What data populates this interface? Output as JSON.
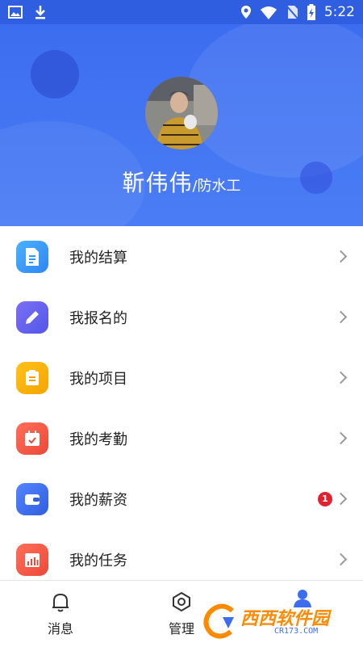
{
  "status_bar": {
    "time": "5:22",
    "left_icons": [
      "image-icon",
      "download-icon"
    ],
    "right_icons": [
      "location-icon",
      "wifi-icon",
      "no-sim-icon",
      "battery-charging-icon"
    ]
  },
  "profile": {
    "name": "靳伟伟",
    "job": "/防水工"
  },
  "menu": {
    "items": [
      {
        "label": "我的结算",
        "icon": "document-icon",
        "color": "#2f9bf5"
      },
      {
        "label": "我报名的",
        "icon": "pencil-icon",
        "color": "#6b63f0"
      },
      {
        "label": "我的项目",
        "icon": "clipboard-icon",
        "color": "#f7b500"
      },
      {
        "label": "我的考勤",
        "icon": "calendar-check-icon",
        "color": "#f25a4a"
      },
      {
        "label": "我的薪资",
        "icon": "wallet-icon",
        "color": "#3f6ff0",
        "badge": "1"
      },
      {
        "label": "我的任务",
        "icon": "chart-calendar-icon",
        "color": "#f25a4a"
      }
    ]
  },
  "tabbar": {
    "tabs": [
      {
        "label": "消息",
        "icon": "bell-icon"
      },
      {
        "label": "管理",
        "icon": "hexagon-icon"
      },
      {
        "label": "",
        "icon": "person-icon"
      }
    ]
  },
  "watermark": {
    "text": "西西软件园",
    "sub": "CR173.COM"
  }
}
